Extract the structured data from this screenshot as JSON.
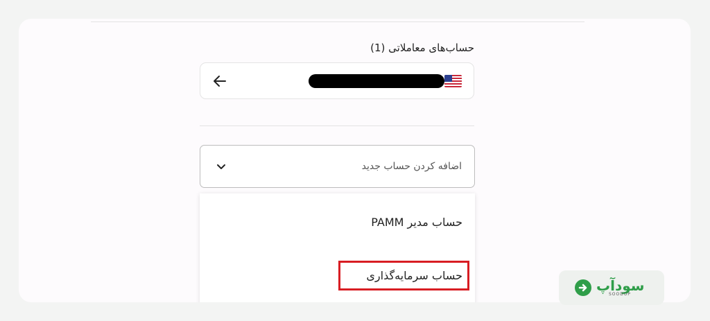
{
  "accounts_section": {
    "title": "حساب‌های معاملاتی (1)",
    "account": {
      "flag": "us-flag-icon",
      "arrow": "arrow-left-icon"
    }
  },
  "new_account_select": {
    "label": "اضافه کردن حساب جدید",
    "chevron": "chevron-down-icon"
  },
  "dropdown": {
    "items": [
      {
        "label": "حساب مدیر PAMM"
      },
      {
        "label": "حساب سرمایه‌گذاری",
        "highlighted": true,
        "highlight_color": "#d81d23"
      }
    ]
  },
  "logo": {
    "text": "سودآپ",
    "subtext": "SOODUP",
    "brand_color": "#2f9e49"
  }
}
